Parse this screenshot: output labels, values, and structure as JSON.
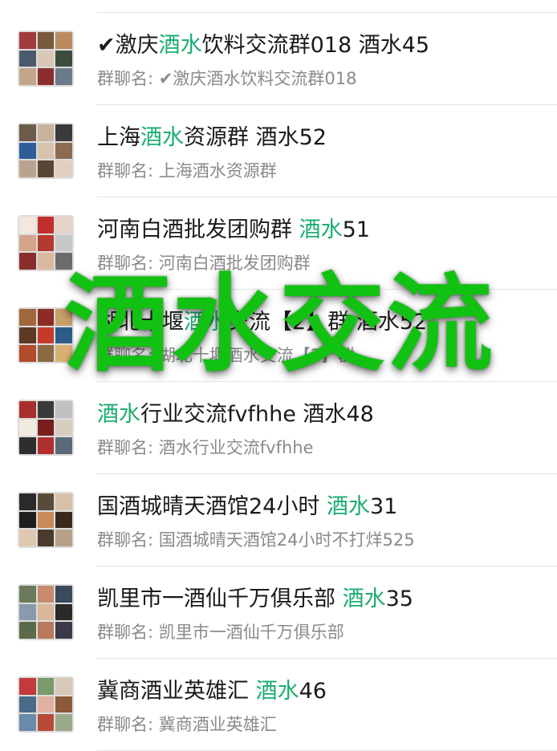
{
  "highlight_color": "#1aad6e",
  "watermark_color": "#12c212",
  "watermark": "酒水交流",
  "groups": [
    {
      "title_pre": "✔激庆",
      "title_hl": "酒水",
      "title_post": "饮料交流群018 酒水45",
      "subtitle": "群聊名: ✔激庆酒水饮料交流群018",
      "avatar_colors": [
        "#a23b3b",
        "#7a5a3c",
        "#b98b5d",
        "#4a5a6c",
        "#d9c7b6",
        "#3c4c3c",
        "#c2a58a",
        "#8b2e2e",
        "#6b7b8b"
      ]
    },
    {
      "title_pre": "上海",
      "title_hl": "酒水",
      "title_post": "资源群 酒水52",
      "subtitle": "群聊名: 上海酒水资源群",
      "avatar_colors": [
        "#6c5a4a",
        "#c9b29a",
        "#3a3a3a",
        "#2f5d9a",
        "#d8c2ae",
        "#8c6b4e",
        "#b8a48e",
        "#5b4636",
        "#e0cfc0"
      ]
    },
    {
      "title_pre": "河南白酒批发团购群 ",
      "title_hl": "酒水",
      "title_post": "51",
      "subtitle": "群聊名: 河南白酒批发团购群",
      "avatar_colors": [
        "#f2e8e0",
        "#c2302e",
        "#e6d2c8",
        "#d4a48a",
        "#b33a2e",
        "#c7c7c7",
        "#8a2d2d",
        "#d9b8a0",
        "#6c6c6c"
      ]
    },
    {
      "title_pre": "湖北十堰",
      "title_hl": "酒水",
      "title_post": "交流【2】群 酒水52",
      "subtitle": "群聊名: 湖北十堰酒水交流【2】群",
      "avatar_colors": [
        "#a0683a",
        "#8e2b24",
        "#c9a06a",
        "#5c3a24",
        "#c43b2c",
        "#2e5c8a",
        "#b24a2c",
        "#8c6a44",
        "#d8b070"
      ]
    },
    {
      "title_pre": "",
      "title_hl": "酒水",
      "title_post": "行业交流fvfhhe 酒水48",
      "subtitle": "群聊名: 酒水行业交流fvfhhe",
      "avatar_colors": [
        "#a82e2e",
        "#3a3a3a",
        "#c0c0c0",
        "#f0eae0",
        "#7a1e1e",
        "#d6cfc0",
        "#2e2e2e",
        "#b03030",
        "#5a6a7a"
      ]
    },
    {
      "title_pre": "国酒城晴天酒馆24小时 ",
      "title_hl": "酒水",
      "title_post": "31",
      "subtitle": "群聊名: 国酒城晴天酒馆24小时不打烊525",
      "avatar_colors": [
        "#2a2a2a",
        "#5a4a3a",
        "#d8c0a8",
        "#1e1e1e",
        "#c88a5a",
        "#3a2a1e",
        "#e0c8b0",
        "#4a3a2e",
        "#b8a088"
      ]
    },
    {
      "title_pre": "凯里市一酒仙千万俱乐部 ",
      "title_hl": "酒水",
      "title_post": "35",
      "subtitle": "群聊名: 凯里市一酒仙千万俱乐部",
      "avatar_colors": [
        "#6a7a5a",
        "#c88a6a",
        "#3a4a5a",
        "#8a9aaa",
        "#d8b898",
        "#2a2a2a",
        "#5a6a4a",
        "#b87a5a",
        "#3a3a4a"
      ]
    },
    {
      "title_pre": "冀商酒业英雄汇 ",
      "title_hl": "酒水",
      "title_post": "46",
      "subtitle": "群聊名: 冀商酒业英雄汇",
      "avatar_colors": [
        "#c23a3a",
        "#7a9a6a",
        "#d8c8b8",
        "#4a6a8a",
        "#e0b0a0",
        "#8a5a3a",
        "#6a8aaa",
        "#b84a3a",
        "#9aaa8a"
      ]
    }
  ]
}
